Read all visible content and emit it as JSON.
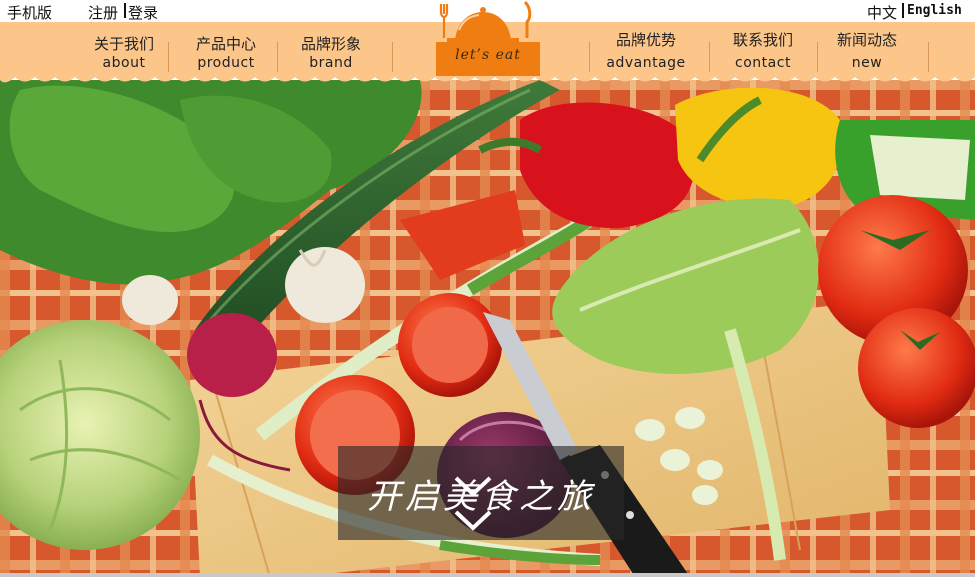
{
  "topbar": {
    "mobile": "手机版",
    "register": "注册",
    "login": "登录",
    "lang_cn": "中文",
    "lang_en": "English"
  },
  "nav": {
    "items": [
      {
        "cn": "关于我们",
        "en": "about"
      },
      {
        "cn": "产品中心",
        "en": "product"
      },
      {
        "cn": "品牌形象",
        "en": "brand"
      },
      {
        "cn": "品牌优势",
        "en": "advantage"
      },
      {
        "cn": "联系我们",
        "en": "contact"
      },
      {
        "cn": "新闻动态",
        "en": "new"
      }
    ]
  },
  "logo": {
    "text": "let’s eat"
  },
  "hero": {
    "caption": "开启美食之旅",
    "scroll_icon": "double-chevron-down-icon"
  },
  "colors": {
    "nav_band": "#fcc68a",
    "logo_orange": "#f07d12",
    "logo_text": "#3b2a10",
    "caption_bg": "#282828"
  }
}
